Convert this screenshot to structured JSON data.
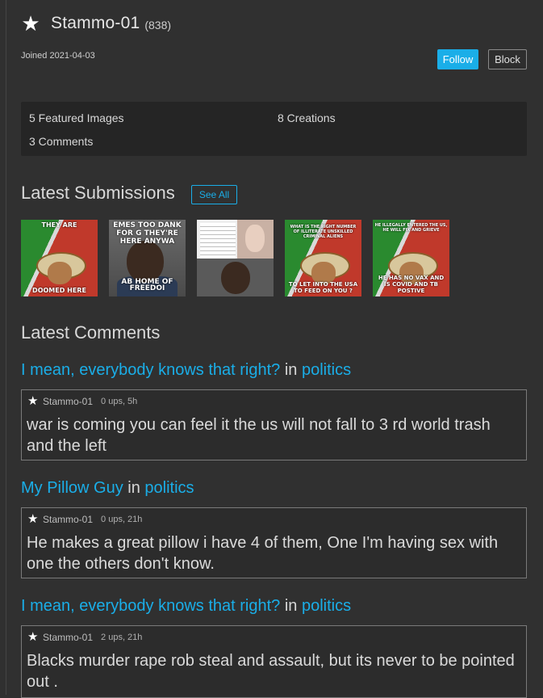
{
  "profile": {
    "username": "Stammo-01",
    "points": "(838)",
    "joined": "Joined 2021-04-03",
    "badge_icon": "star-icon"
  },
  "actions": {
    "follow_label": "Follow",
    "block_label": "Block"
  },
  "stats": {
    "featured": "5 Featured Images",
    "creations": "8 Creations",
    "comments": "3 Comments"
  },
  "submissions": {
    "title": "Latest Submissions",
    "see_all": "See All",
    "images": [
      {
        "top": "THEY ARE",
        "bottom": "DOOMED HERE"
      },
      {
        "top": "EMES TOO DANK FOR G THEY'RE HERE ANYWA",
        "bottom": "AB HOME OF FREEDOI"
      },
      {
        "top": "",
        "bottom": ""
      },
      {
        "top": "WHAT IS THE RIGHT NUMBER OF ILLITERATE UNSKILLED CRIMINAL ALIENS",
        "bottom": "TO LET INTO THE USA TO FEED ON YOU ?"
      },
      {
        "top": "HE ILLEGALLY ENTERED THE US, HE WILL FIX AND GRIEVE",
        "bottom": "HE HAS NO VAX AND IS COVID AND TB POSTIVE"
      }
    ]
  },
  "comments": {
    "title": "Latest Comments",
    "items": [
      {
        "post": "I mean, everybody knows that right?",
        "in": "in",
        "stream": "politics",
        "user": "Stammo-01",
        "meta": "0 ups, 5h",
        "text": "war is coming you can feel it the us will not fall to 3 rd world trash and the left"
      },
      {
        "post": "My Pillow Guy",
        "in": "in",
        "stream": "politics",
        "user": "Stammo-01",
        "meta": "0 ups, 21h",
        "text": "He makes a great pillow i have 4 of them, One I'm having sex with one the others don't know."
      },
      {
        "post": "I mean, everybody knows that right?",
        "in": "in",
        "stream": "politics",
        "user": "Stammo-01",
        "meta": "2 ups, 21h",
        "text": "Blacks murder rape rob steal and assault, but its never to be pointed out ."
      }
    ]
  },
  "colors": {
    "accent": "#1aaee8",
    "background": "#303030",
    "panel": "#252525"
  }
}
